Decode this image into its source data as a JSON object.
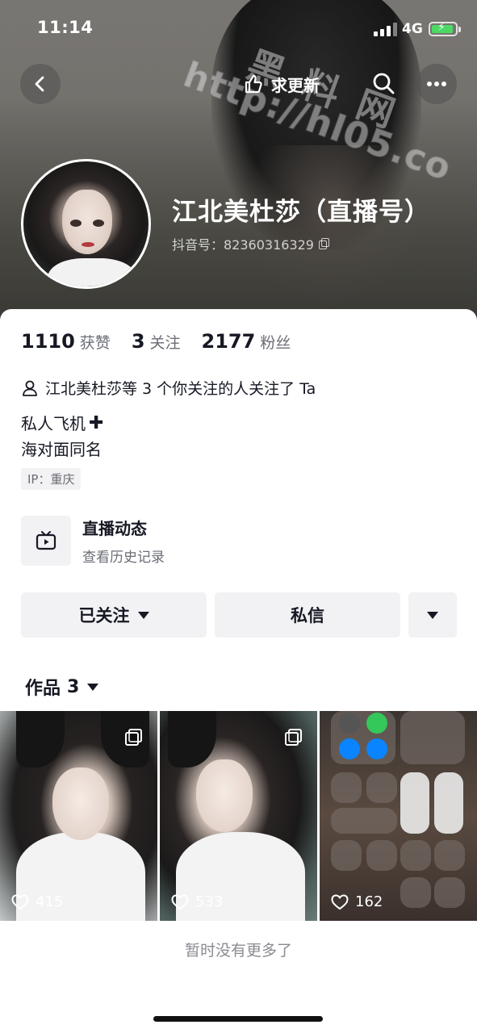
{
  "status_bar": {
    "time": "11:14",
    "network": "4G"
  },
  "watermark": {
    "line1": "黑料网",
    "line2": "http://hl05.co"
  },
  "header": {
    "update_request_label": "求更新"
  },
  "profile": {
    "name": "江北美杜莎（直播号）",
    "douyin_id": "抖音号：82360316329"
  },
  "stats": [
    {
      "value": "1110",
      "label": "获赞"
    },
    {
      "value": "3",
      "label": "关注"
    },
    {
      "value": "2177",
      "label": "粉丝"
    }
  ],
  "mutual_followers": "江北美杜莎等 3 个你关注的人关注了 Ta",
  "bio": {
    "line1": "私人飞机",
    "line2": "海对面同名"
  },
  "ip_location": "IP：重庆",
  "live_card": {
    "title": "直播动态",
    "subtitle": "查看历史记录"
  },
  "actions": {
    "follow_label": "已关注",
    "message_label": "私信"
  },
  "works": {
    "label": "作品",
    "count": "3"
  },
  "videos": [
    {
      "likes": "415",
      "multi_image": true
    },
    {
      "likes": "533",
      "multi_image": true
    },
    {
      "likes": "162",
      "multi_image": false
    }
  ],
  "footer": {
    "no_more": "暂时没有更多了"
  },
  "colors": {
    "accent_text": "#161823",
    "secondary_text": "#6b6d76",
    "button_bg": "#f2f2f4",
    "battery": "#4cd964"
  }
}
